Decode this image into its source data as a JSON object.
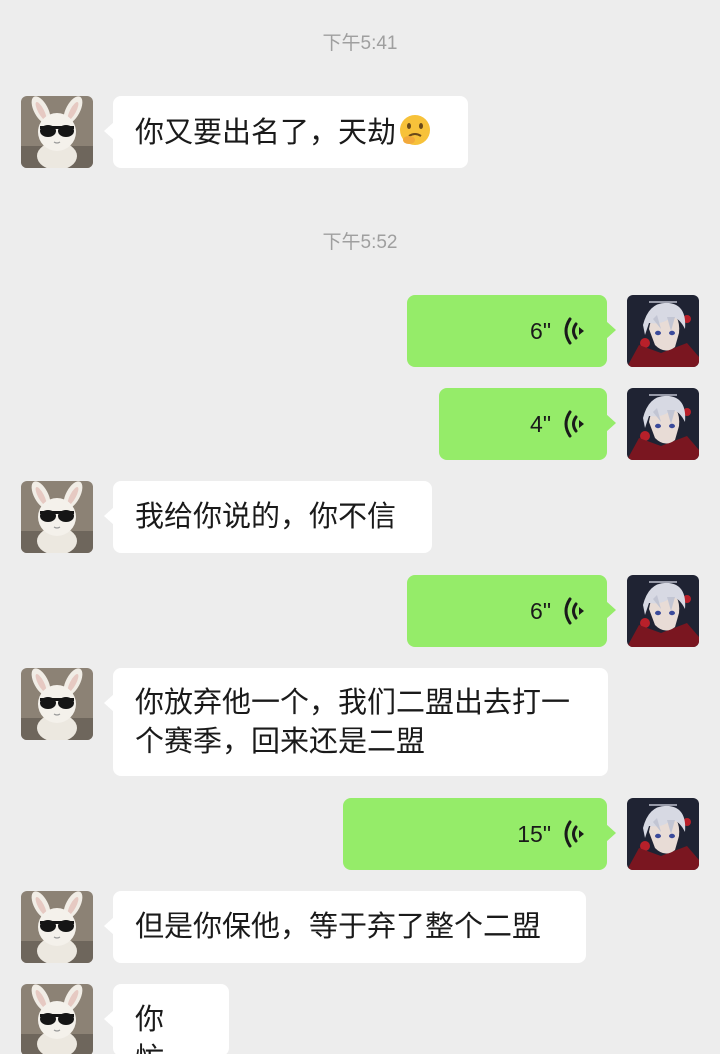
{
  "chat": {
    "timestamps": [
      "下午5:41",
      "下午5:52"
    ],
    "messages": [
      {
        "side": "in",
        "type": "text",
        "text": "你又要出名了，天劫",
        "emoji": "thinking-face-emoji"
      },
      {
        "side": "out",
        "type": "voice",
        "duration": "6\""
      },
      {
        "side": "out",
        "type": "voice",
        "duration": "4\""
      },
      {
        "side": "in",
        "type": "text",
        "text": "我给你说的，你不信"
      },
      {
        "side": "out",
        "type": "voice",
        "duration": "6\""
      },
      {
        "side": "in",
        "type": "text",
        "lines": [
          "你放弃他一个，我们二盟出去打一",
          "个赛季，回来还是二盟"
        ]
      },
      {
        "side": "out",
        "type": "voice",
        "duration": "15\""
      },
      {
        "side": "in",
        "type": "text",
        "text": "但是你保他，等于弃了整个二盟"
      },
      {
        "side": "in",
        "type": "text",
        "text": "你忙，"
      }
    ]
  },
  "colors": {
    "background": "#ededed",
    "incoming_bubble": "#ffffff",
    "outgoing_bubble": "#95ec69",
    "timestamp_text": "#9f9f9f"
  },
  "icons": {
    "voice": "voice-wave-icon",
    "contact_avatar": "bunny-sunglasses-avatar",
    "self_avatar": "anime-character-avatar"
  }
}
